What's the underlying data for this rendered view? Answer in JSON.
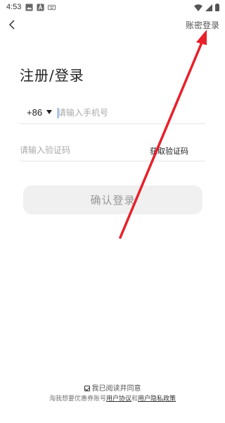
{
  "status_bar": {
    "time": "4:53"
  },
  "header": {
    "account_login_label": "账密登录"
  },
  "main": {
    "title": "注册/登录",
    "phone": {
      "country_code": "+86",
      "placeholder": "请输入手机号",
      "value": ""
    },
    "code": {
      "placeholder": "请输入验证码",
      "value": "",
      "get_code_label": "获取验证码"
    },
    "confirm_label": "确认登录"
  },
  "footer": {
    "agree_text": "我已阅读并同意",
    "terms_prefix": "淘我想要优惠券账号",
    "user_agreement": "用户协议",
    "and": "和",
    "privacy_policy": "用户隐私政策"
  },
  "colors": {
    "annotation_arrow": "#e8202a",
    "caret": "#2c7be5",
    "button_bg": "#f0f0f0"
  }
}
